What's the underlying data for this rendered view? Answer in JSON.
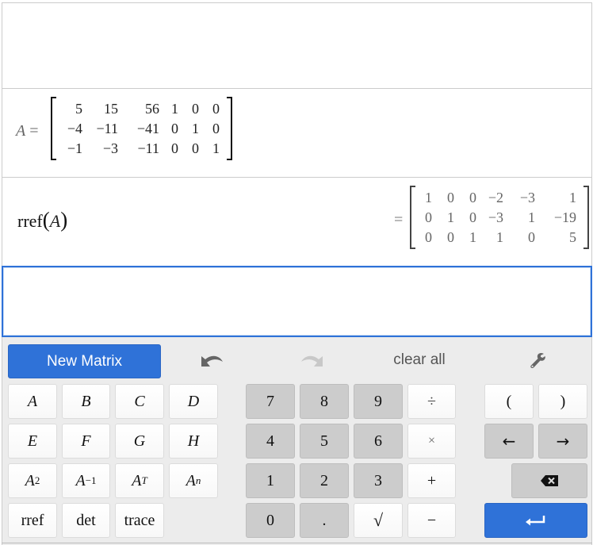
{
  "expressions": [
    {
      "index": 0,
      "content": ""
    },
    {
      "index": 1,
      "variable": "A",
      "operator": "=",
      "matrix": [
        [
          "5",
          "15",
          "56",
          "1",
          "0",
          "0"
        ],
        [
          "−4",
          "−11",
          "−41",
          "0",
          "1",
          "0"
        ],
        [
          "−1",
          "−3",
          "−11",
          "0",
          "0",
          "1"
        ]
      ]
    },
    {
      "index": 2,
      "function": "rref",
      "open_paren": "(",
      "argument": "A",
      "close_paren": ")",
      "result_operator": "=",
      "result": [
        [
          "1",
          "0",
          "0",
          "−2",
          "−3",
          "1"
        ],
        [
          "0",
          "1",
          "0",
          "−3",
          "1",
          "−19"
        ],
        [
          "0",
          "0",
          "1",
          "1",
          "0",
          "5"
        ]
      ]
    },
    {
      "index": 3,
      "content": "",
      "focused": true
    }
  ],
  "keypad": {
    "new_matrix_label": "New Matrix",
    "undo_icon": "undo-arrow",
    "redo_icon": "redo-arrow",
    "clear_all_label": "clear all",
    "settings_icon": "wrench",
    "matrix_keys": {
      "row1": [
        "A",
        "B",
        "C",
        "D"
      ],
      "row2": [
        "E",
        "F",
        "G",
        "H"
      ],
      "powers": {
        "base": "A",
        "square": "2",
        "inverse": "−1",
        "transpose": "T",
        "power": "n"
      },
      "functions": [
        "rref",
        "det",
        "trace"
      ]
    },
    "number_keys": {
      "row1": [
        "7",
        "8",
        "9",
        "÷"
      ],
      "row2": [
        "4",
        "5",
        "6",
        "×"
      ],
      "row3": [
        "1",
        "2",
        "3",
        "+"
      ],
      "row4": [
        "0",
        ".",
        "√",
        "−"
      ]
    },
    "nav_keys": {
      "open_paren": "(",
      "close_paren": ")",
      "left_arrow": "←",
      "right_arrow": "→",
      "backspace_icon": "backspace",
      "enter_icon": "return"
    }
  },
  "colors": {
    "accent_blue": "#2f72d8",
    "keypad_background": "#ececec",
    "dark_key": "#cccccc",
    "light_key": "#ffffff"
  }
}
